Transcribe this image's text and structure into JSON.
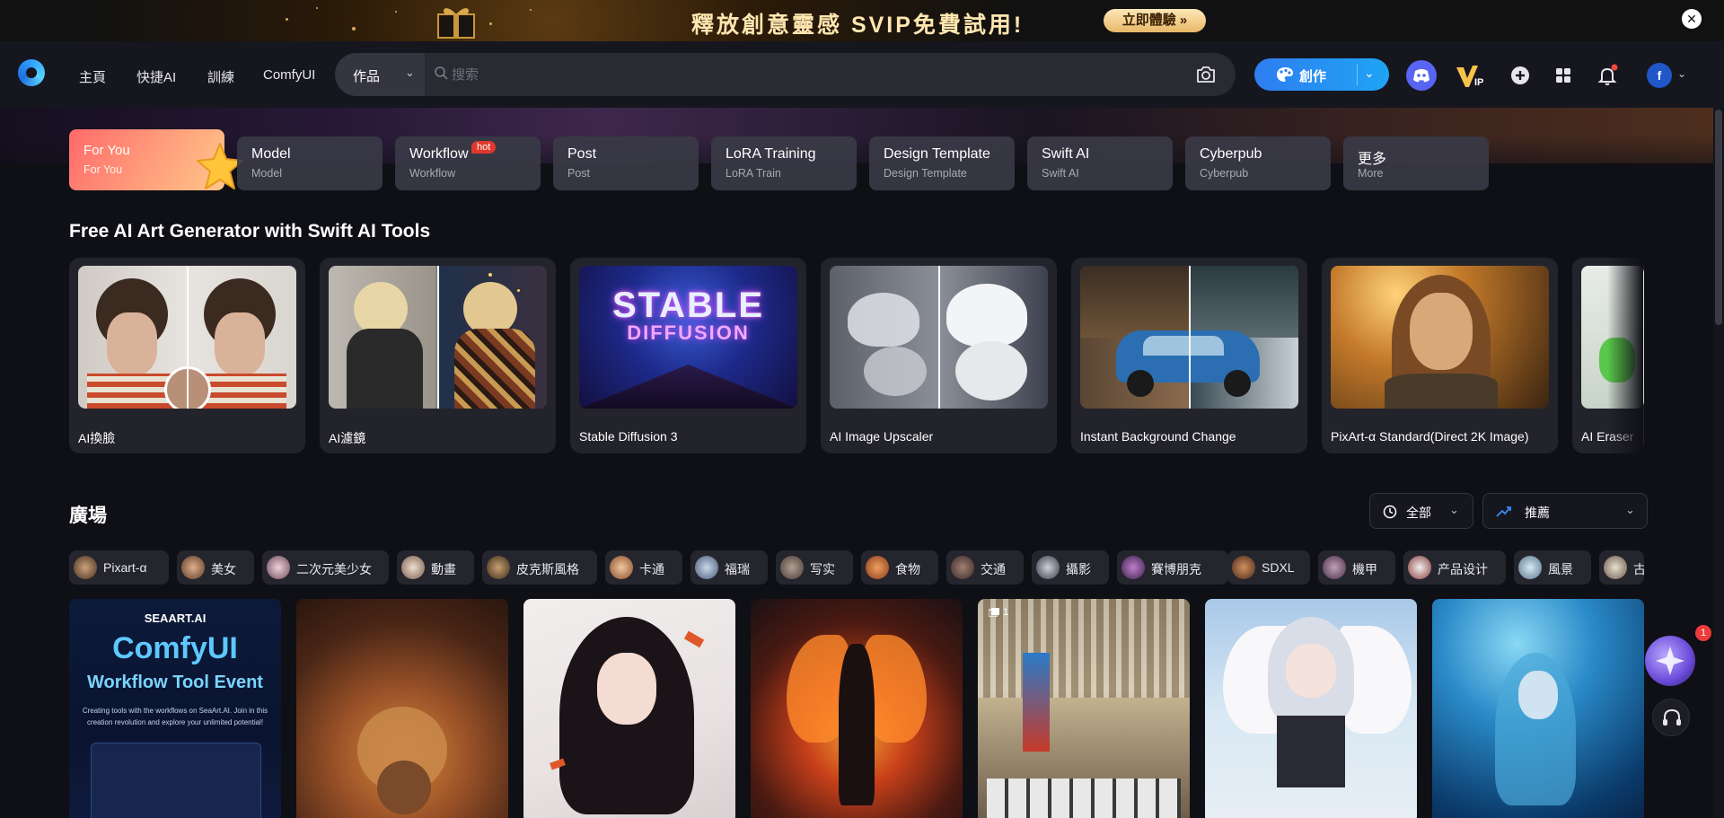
{
  "promo": {
    "text": "釋放創意靈感 SVIP免費試用!",
    "button": "立即體驗 »",
    "close": "✕"
  },
  "header": {
    "nav": [
      "主頁",
      "快捷AI",
      "訓練",
      "ComfyUI"
    ],
    "search": {
      "scope": "作品",
      "placeholder": "搜索"
    },
    "create_label": "創作",
    "avatar_letter": "f"
  },
  "categories": [
    {
      "title": "For You",
      "sub": "For You"
    },
    {
      "title": "Model",
      "sub": "Model"
    },
    {
      "title": "Workflow",
      "sub": "Workflow",
      "badge": "hot"
    },
    {
      "title": "Post",
      "sub": "Post"
    },
    {
      "title": "LoRA Training",
      "sub": "LoRA Train"
    },
    {
      "title": "Design Template",
      "sub": "Design Template"
    },
    {
      "title": "Swift AI",
      "sub": "Swift AI"
    },
    {
      "title": "Cyberpub",
      "sub": "Cyberpub"
    },
    {
      "title": "更多",
      "sub": "More"
    }
  ],
  "tools_section": {
    "title": "Free AI Art Generator with Swift AI Tools",
    "tools": [
      "AI換臉",
      "AI濾鏡",
      "Stable Diffusion 3",
      "AI Image Upscaler",
      "Instant Background Change",
      "PixArt-α Standard(Direct 2K Image)",
      "AI Eraser"
    ],
    "sd3_overlay_line1": "STABLE",
    "sd3_overlay_line2": "DIFFUSION"
  },
  "square": {
    "title": "廣場",
    "time_filter": "全部",
    "sort_filter": "推薦",
    "tags": [
      "Pixart-α",
      "美女",
      "二次元美少女",
      "動畫",
      "皮克斯風格",
      "卡通",
      "福瑞",
      "写实",
      "食物",
      "交通",
      "攝影",
      "賽博朋克",
      "SDXL",
      "機甲",
      "产品设计",
      "風景",
      "古"
    ]
  },
  "feed": {
    "promo_card": {
      "brand": "SEAART.AI",
      "title": "ComfyUI",
      "subtitle": "Workflow Tool Event",
      "desc": "Creating tools with the workflows on SeaArt.AI. Join in this creation revolution and explore your unlimited potential!"
    },
    "multi_badge": "1"
  },
  "floating": {
    "badge": "1"
  },
  "colors": {
    "accent": "#2e7ef0",
    "bg": "#0f0f16",
    "card": "#23232b",
    "hot": "#e0382d"
  }
}
